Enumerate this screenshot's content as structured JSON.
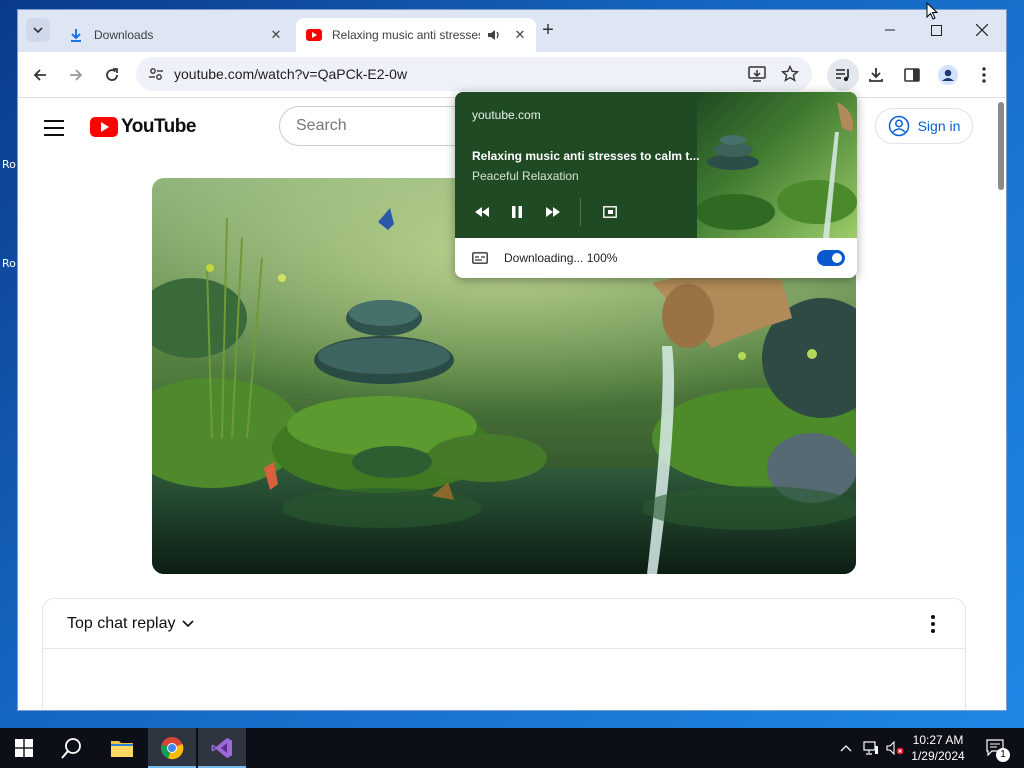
{
  "browser": {
    "tabs": [
      {
        "title": "Downloads",
        "icon": "download-icon",
        "active": false
      },
      {
        "title": "Relaxing music anti stresses",
        "icon": "youtube-icon",
        "active": true,
        "audio": true
      }
    ],
    "address": "youtube.com/watch?v=QaPCk-E2-0w"
  },
  "youtube": {
    "logo_text": "YouTube",
    "search_placeholder": "Search",
    "sign_in_label": "Sign in",
    "chat_header": "Top chat replay"
  },
  "media_popup": {
    "origin": "youtube.com",
    "title": "Relaxing music anti stresses to calm t...",
    "artist": "Peaceful Relaxation",
    "status": "Downloading... 100%",
    "live_caption_enabled": true
  },
  "desktop": {
    "icon_labels": [
      "Ro",
      "Ro"
    ]
  },
  "taskbar": {
    "time": "10:27 AM",
    "date": "1/29/2024",
    "notification_count": "1"
  },
  "colors": {
    "youtube_red": "#ff0000",
    "toggle_blue": "#0b57d0",
    "media_bg": "#1f4a23"
  }
}
